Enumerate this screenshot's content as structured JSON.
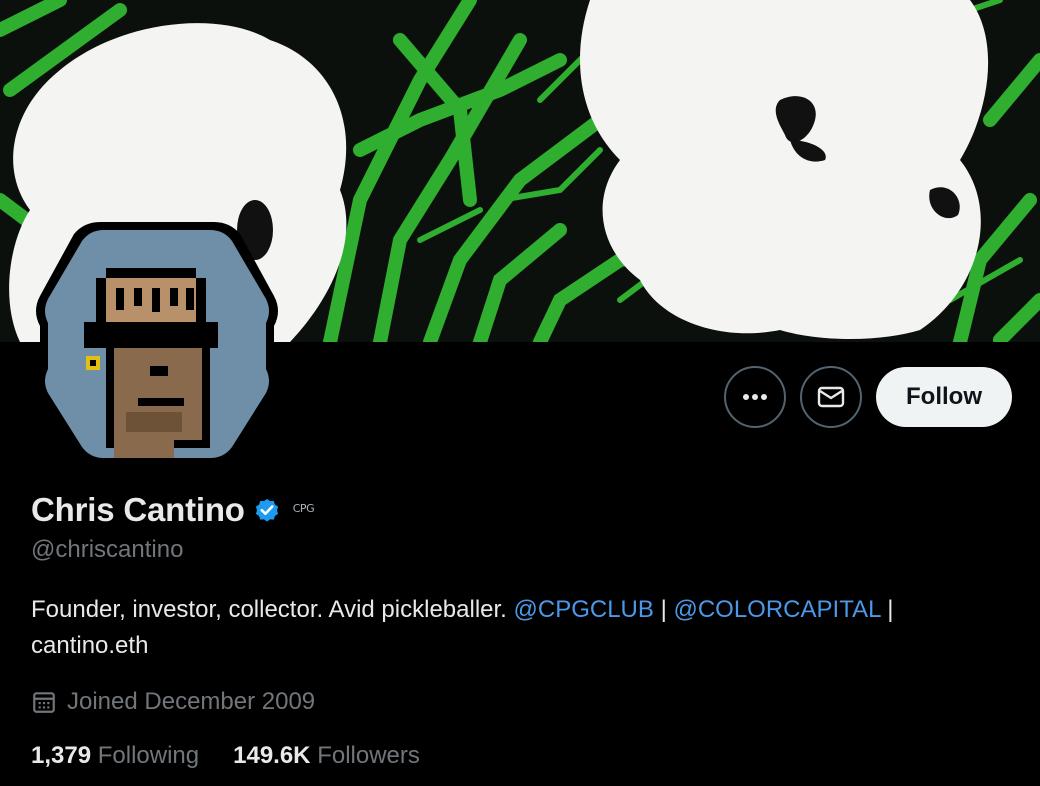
{
  "profile": {
    "name": "Chris Cantino",
    "affiliation": "CPG",
    "handle": "@chriscantino",
    "bio": {
      "text": "Founder, investor, collector. Avid pickleballer.",
      "mention1": "@CPGCLUB",
      "separator1": "|",
      "mention2": "@COLORCAPITAL",
      "separator2": "|",
      "link": "cantino.eth"
    },
    "joined": "Joined December 2009",
    "following_count": "1,379",
    "following_label": "Following",
    "followers_count": "149.6K",
    "followers_label": "Followers"
  },
  "actions": {
    "more_icon": "more-icon",
    "message_icon": "envelope-icon",
    "follow_label": "Follow"
  },
  "colors": {
    "background": "#000000",
    "link": "#4a99e9",
    "verified": "#1d9bf0",
    "muted": "#71767b",
    "banner_green": "#2fae2f",
    "avatar_bg": "#6f8ea8"
  }
}
